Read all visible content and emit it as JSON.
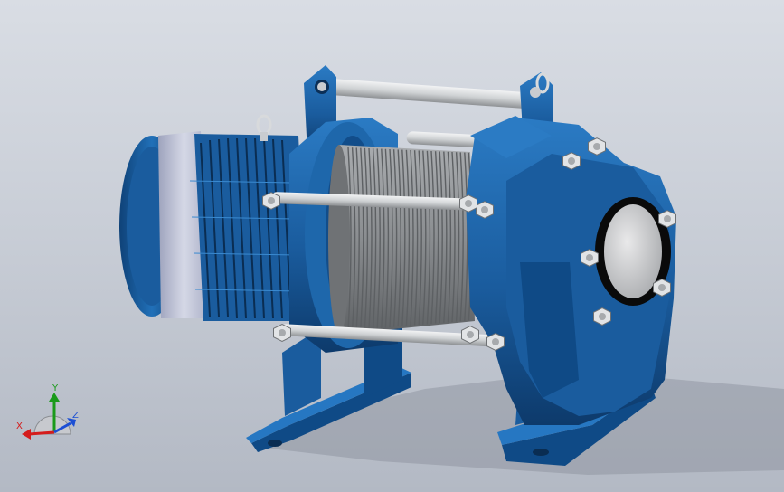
{
  "viewport": {
    "model": "electric-winch-assembly"
  },
  "triad": {
    "x_label": "X",
    "y_label": "Y",
    "z_label": "Z",
    "x_color": "#d41c1c",
    "y_color": "#1a9a1a",
    "z_color": "#1c4fd4"
  },
  "colors": {
    "body_blue": "#1a5c9e",
    "body_blue_dark": "#0d3a6b",
    "body_blue_light": "#2b7bc4",
    "drum_gray": "#8a8d90",
    "rod_silver": "#d6d8da",
    "bolt_silver": "#e2e4e6",
    "fan_cover": "#bfc3d6"
  }
}
